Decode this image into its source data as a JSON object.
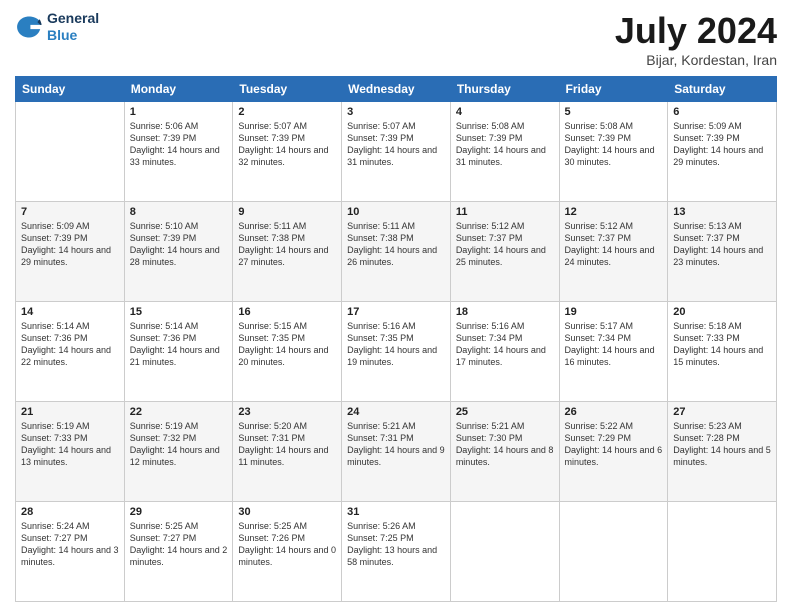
{
  "header": {
    "logo_line1": "General",
    "logo_line2": "Blue",
    "title": "July 2024",
    "subtitle": "Bijar, Kordestan, Iran"
  },
  "days_of_week": [
    "Sunday",
    "Monday",
    "Tuesday",
    "Wednesday",
    "Thursday",
    "Friday",
    "Saturday"
  ],
  "weeks": [
    [
      {
        "day": null,
        "sunrise": null,
        "sunset": null,
        "daylight": null
      },
      {
        "day": "1",
        "sunrise": "Sunrise: 5:06 AM",
        "sunset": "Sunset: 7:39 PM",
        "daylight": "Daylight: 14 hours and 33 minutes."
      },
      {
        "day": "2",
        "sunrise": "Sunrise: 5:07 AM",
        "sunset": "Sunset: 7:39 PM",
        "daylight": "Daylight: 14 hours and 32 minutes."
      },
      {
        "day": "3",
        "sunrise": "Sunrise: 5:07 AM",
        "sunset": "Sunset: 7:39 PM",
        "daylight": "Daylight: 14 hours and 31 minutes."
      },
      {
        "day": "4",
        "sunrise": "Sunrise: 5:08 AM",
        "sunset": "Sunset: 7:39 PM",
        "daylight": "Daylight: 14 hours and 31 minutes."
      },
      {
        "day": "5",
        "sunrise": "Sunrise: 5:08 AM",
        "sunset": "Sunset: 7:39 PM",
        "daylight": "Daylight: 14 hours and 30 minutes."
      },
      {
        "day": "6",
        "sunrise": "Sunrise: 5:09 AM",
        "sunset": "Sunset: 7:39 PM",
        "daylight": "Daylight: 14 hours and 29 minutes."
      }
    ],
    [
      {
        "day": "7",
        "sunrise": "Sunrise: 5:09 AM",
        "sunset": "Sunset: 7:39 PM",
        "daylight": "Daylight: 14 hours and 29 minutes."
      },
      {
        "day": "8",
        "sunrise": "Sunrise: 5:10 AM",
        "sunset": "Sunset: 7:39 PM",
        "daylight": "Daylight: 14 hours and 28 minutes."
      },
      {
        "day": "9",
        "sunrise": "Sunrise: 5:11 AM",
        "sunset": "Sunset: 7:38 PM",
        "daylight": "Daylight: 14 hours and 27 minutes."
      },
      {
        "day": "10",
        "sunrise": "Sunrise: 5:11 AM",
        "sunset": "Sunset: 7:38 PM",
        "daylight": "Daylight: 14 hours and 26 minutes."
      },
      {
        "day": "11",
        "sunrise": "Sunrise: 5:12 AM",
        "sunset": "Sunset: 7:37 PM",
        "daylight": "Daylight: 14 hours and 25 minutes."
      },
      {
        "day": "12",
        "sunrise": "Sunrise: 5:12 AM",
        "sunset": "Sunset: 7:37 PM",
        "daylight": "Daylight: 14 hours and 24 minutes."
      },
      {
        "day": "13",
        "sunrise": "Sunrise: 5:13 AM",
        "sunset": "Sunset: 7:37 PM",
        "daylight": "Daylight: 14 hours and 23 minutes."
      }
    ],
    [
      {
        "day": "14",
        "sunrise": "Sunrise: 5:14 AM",
        "sunset": "Sunset: 7:36 PM",
        "daylight": "Daylight: 14 hours and 22 minutes."
      },
      {
        "day": "15",
        "sunrise": "Sunrise: 5:14 AM",
        "sunset": "Sunset: 7:36 PM",
        "daylight": "Daylight: 14 hours and 21 minutes."
      },
      {
        "day": "16",
        "sunrise": "Sunrise: 5:15 AM",
        "sunset": "Sunset: 7:35 PM",
        "daylight": "Daylight: 14 hours and 20 minutes."
      },
      {
        "day": "17",
        "sunrise": "Sunrise: 5:16 AM",
        "sunset": "Sunset: 7:35 PM",
        "daylight": "Daylight: 14 hours and 19 minutes."
      },
      {
        "day": "18",
        "sunrise": "Sunrise: 5:16 AM",
        "sunset": "Sunset: 7:34 PM",
        "daylight": "Daylight: 14 hours and 17 minutes."
      },
      {
        "day": "19",
        "sunrise": "Sunrise: 5:17 AM",
        "sunset": "Sunset: 7:34 PM",
        "daylight": "Daylight: 14 hours and 16 minutes."
      },
      {
        "day": "20",
        "sunrise": "Sunrise: 5:18 AM",
        "sunset": "Sunset: 7:33 PM",
        "daylight": "Daylight: 14 hours and 15 minutes."
      }
    ],
    [
      {
        "day": "21",
        "sunrise": "Sunrise: 5:19 AM",
        "sunset": "Sunset: 7:33 PM",
        "daylight": "Daylight: 14 hours and 13 minutes."
      },
      {
        "day": "22",
        "sunrise": "Sunrise: 5:19 AM",
        "sunset": "Sunset: 7:32 PM",
        "daylight": "Daylight: 14 hours and 12 minutes."
      },
      {
        "day": "23",
        "sunrise": "Sunrise: 5:20 AM",
        "sunset": "Sunset: 7:31 PM",
        "daylight": "Daylight: 14 hours and 11 minutes."
      },
      {
        "day": "24",
        "sunrise": "Sunrise: 5:21 AM",
        "sunset": "Sunset: 7:31 PM",
        "daylight": "Daylight: 14 hours and 9 minutes."
      },
      {
        "day": "25",
        "sunrise": "Sunrise: 5:21 AM",
        "sunset": "Sunset: 7:30 PM",
        "daylight": "Daylight: 14 hours and 8 minutes."
      },
      {
        "day": "26",
        "sunrise": "Sunrise: 5:22 AM",
        "sunset": "Sunset: 7:29 PM",
        "daylight": "Daylight: 14 hours and 6 minutes."
      },
      {
        "day": "27",
        "sunrise": "Sunrise: 5:23 AM",
        "sunset": "Sunset: 7:28 PM",
        "daylight": "Daylight: 14 hours and 5 minutes."
      }
    ],
    [
      {
        "day": "28",
        "sunrise": "Sunrise: 5:24 AM",
        "sunset": "Sunset: 7:27 PM",
        "daylight": "Daylight: 14 hours and 3 minutes."
      },
      {
        "day": "29",
        "sunrise": "Sunrise: 5:25 AM",
        "sunset": "Sunset: 7:27 PM",
        "daylight": "Daylight: 14 hours and 2 minutes."
      },
      {
        "day": "30",
        "sunrise": "Sunrise: 5:25 AM",
        "sunset": "Sunset: 7:26 PM",
        "daylight": "Daylight: 14 hours and 0 minutes."
      },
      {
        "day": "31",
        "sunrise": "Sunrise: 5:26 AM",
        "sunset": "Sunset: 7:25 PM",
        "daylight": "Daylight: 13 hours and 58 minutes."
      },
      {
        "day": null,
        "sunrise": null,
        "sunset": null,
        "daylight": null
      },
      {
        "day": null,
        "sunrise": null,
        "sunset": null,
        "daylight": null
      },
      {
        "day": null,
        "sunrise": null,
        "sunset": null,
        "daylight": null
      }
    ]
  ]
}
